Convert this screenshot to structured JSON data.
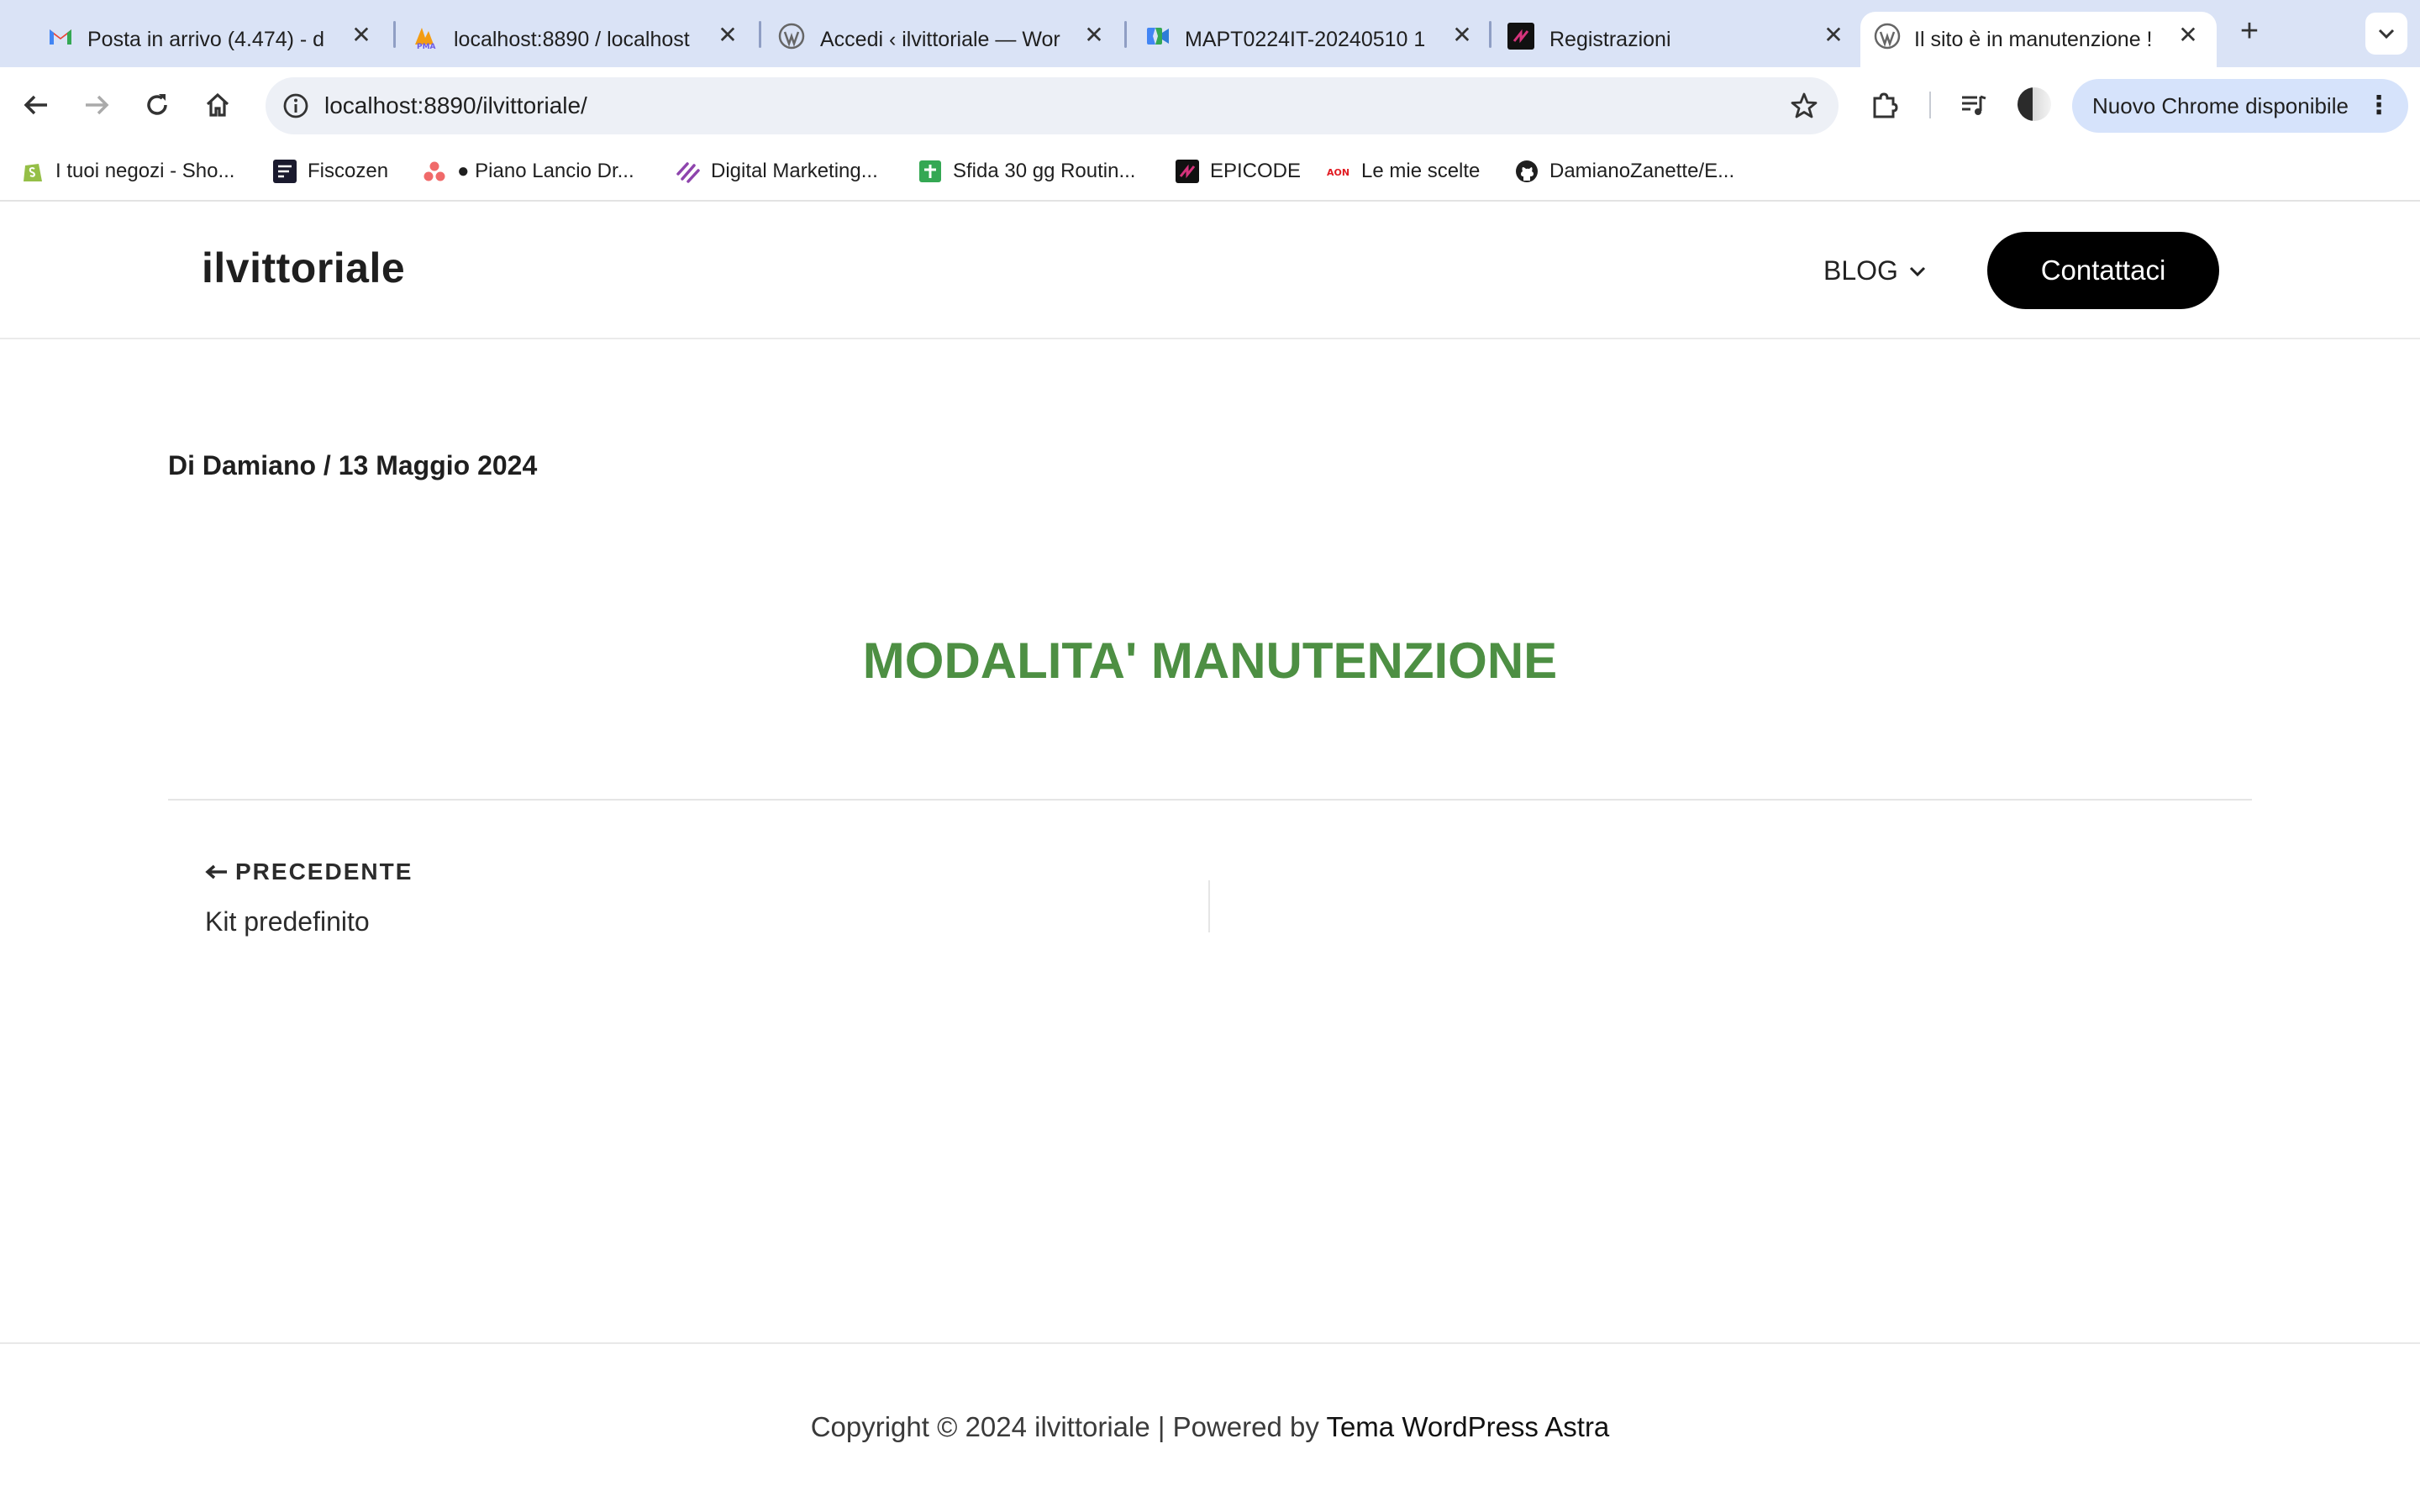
{
  "browser": {
    "tabs": [
      {
        "title": "Posta in arrivo (4.474) - d",
        "icon": "gmail-icon",
        "active": false
      },
      {
        "title": "localhost:8890 / localhost",
        "icon": "phpmyadmin-icon",
        "active": false
      },
      {
        "title": "Accedi ‹ ilvittoriale — Wor",
        "icon": "wordpress-icon",
        "active": false
      },
      {
        "title": "MAPT0224IT-20240510 1",
        "icon": "meet-icon",
        "active": false
      },
      {
        "title": "Registrazioni",
        "icon": "epicode-icon",
        "active": false
      },
      {
        "title": "Il sito è in manutenzione !",
        "icon": "wordpress-icon",
        "active": true
      }
    ],
    "url": "localhost:8890/ilvittoriale/",
    "update_button": "Nuovo Chrome disponibile",
    "bookmarks": [
      {
        "label": "I tuoi negozi - Sho...",
        "icon": "shopify-icon"
      },
      {
        "label": "Fiscozen",
        "icon": "fiscozen-icon"
      },
      {
        "label": "● Piano Lancio Dr...",
        "icon": "asana-icon"
      },
      {
        "label": "Digital Marketing...",
        "icon": "stripes-icon"
      },
      {
        "label": "Sfida 30 gg Routin...",
        "icon": "sheets-icon"
      },
      {
        "label": "EPICODE",
        "icon": "epicode-icon"
      },
      {
        "label": "Le mie scelte",
        "icon": "aon-icon"
      },
      {
        "label": "DamianoZanette/E...",
        "icon": "github-icon"
      }
    ]
  },
  "site": {
    "title": "ilvittoriale",
    "nav_blog": "BLOG",
    "contact_button": "Contattaci"
  },
  "post": {
    "meta": "Di Damiano / 13 Maggio 2024",
    "title": "MODALITA' MANUTENZIONE",
    "prev_label": "PRECEDENTE",
    "prev_title": "Kit predefinito"
  },
  "footer": {
    "text": "Copyright © 2024 ilvittoriale | Powered by",
    "theme_link": "Tema WordPress Astra"
  },
  "colors": {
    "title_green": "#4d8f43",
    "tabstrip": "#dae3f6",
    "button_black": "#000000"
  }
}
